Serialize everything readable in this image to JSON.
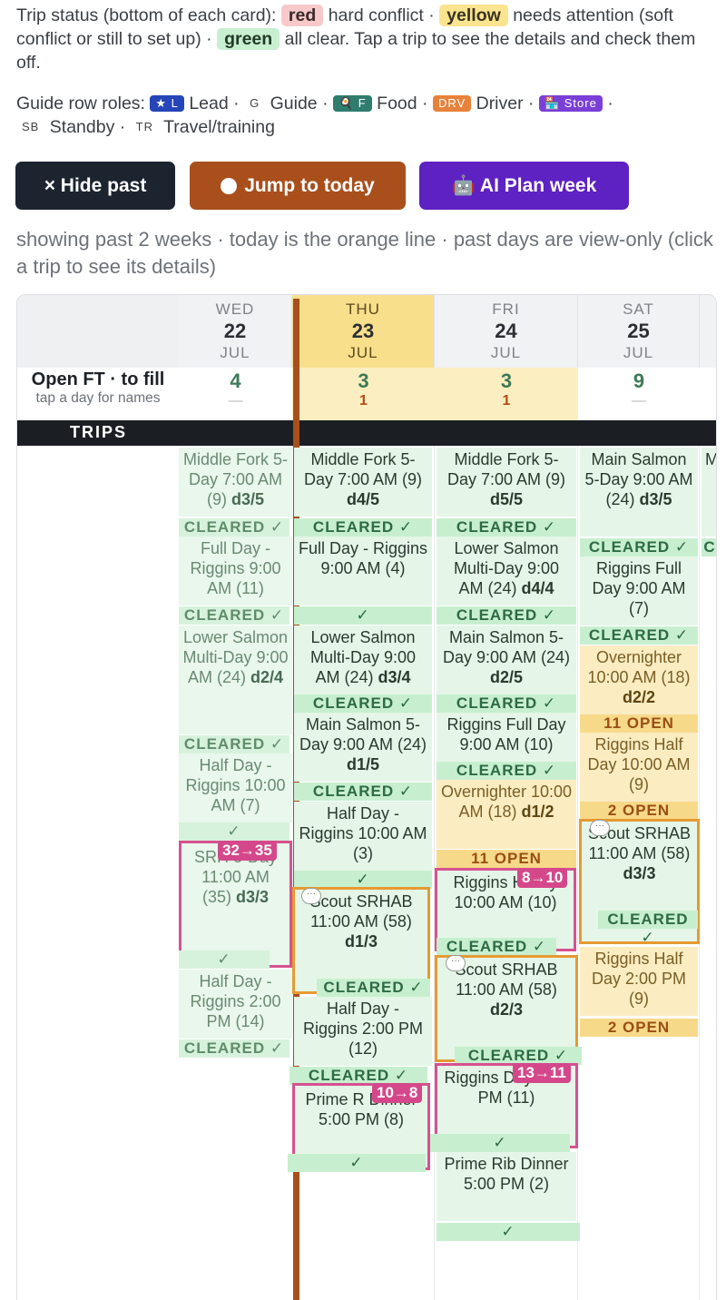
{
  "legend": {
    "status_intro": "Trip status (bottom of each card):",
    "red_label": "red",
    "red_desc": "hard conflict ·",
    "yellow_label": "yellow",
    "yellow_desc": "needs attention (soft conflict or still to set up) ·",
    "green_label": "green",
    "green_desc": "all clear. Tap a trip to see the details and check them off.",
    "roles_intro": "Guide row roles:",
    "roles": [
      {
        "badge": "★ L",
        "name": "Lead"
      },
      {
        "badge": "G",
        "name": "Guide"
      },
      {
        "badge": "🍳 F",
        "name": "Food"
      },
      {
        "badge": "DRV",
        "name": "Driver"
      },
      {
        "badge": "🏪 Store",
        "name": ""
      },
      {
        "badge": "SB",
        "name": "Standby"
      },
      {
        "badge": "TR",
        "name": "Travel/training"
      }
    ],
    "sep": "·"
  },
  "toolbar": {
    "hide_past": "× Hide past",
    "jump_today": "Jump to today",
    "ai_plan": "🤖  AI Plan week"
  },
  "subnote": "showing past 2 weeks · today is the orange line · past days are view-only (click a trip to see its details)",
  "days": [
    {
      "dow": "WED",
      "num": "22",
      "mon": "JUL",
      "open": "4",
      "open_sub": "—"
    },
    {
      "dow": "THU",
      "num": "23",
      "mon": "JUL",
      "open": "3",
      "open_sub": "1"
    },
    {
      "dow": "FRI",
      "num": "24",
      "mon": "JUL",
      "open": "3",
      "open_sub": "1"
    },
    {
      "dow": "SAT",
      "num": "25",
      "mon": "JUL",
      "open": "9",
      "open_sub": "—"
    }
  ],
  "open_row": {
    "title": "Open FT · to fill",
    "sub": "tap a day for names"
  },
  "trips_label": "TRIPS",
  "cards": {
    "wed": [
      {
        "text": "Middle Fork 5-Day 7:00 AM (9)",
        "day": "d3/5",
        "status": "CLEARED ✓"
      },
      {
        "text": "Full Day - Riggins 9:00 AM (11)",
        "day": "",
        "status": "CLEARED ✓"
      },
      {
        "text": "Lower Salmon Multi-Day 9:00 AM (24)",
        "day": "d2/4",
        "status": "CLEARED ✓"
      },
      {
        "text": "Half Day - Riggins 10:00 AM (7)",
        "day": "",
        "status": "✓"
      },
      {
        "text": "SRH 3-Day 11:00 AM (35)",
        "day": "d3/3",
        "status": "✓",
        "badge": "32→35"
      },
      {
        "text": "Half Day - Riggins 2:00 PM (14)",
        "day": "",
        "status": "CLEARED ✓"
      }
    ],
    "thu": [
      {
        "text": "Middle Fork 5-Day 7:00 AM (9)",
        "day": "d4/5",
        "status": "CLEARED ✓"
      },
      {
        "text": "Full Day - Riggins 9:00 AM (4)",
        "day": "",
        "status": "✓"
      },
      {
        "text": "Lower Salmon Multi-Day 9:00 AM (24)",
        "day": "d3/4",
        "status": "CLEARED ✓"
      },
      {
        "text": "Main Salmon 5-Day 9:00 AM (24)",
        "day": "d1/5",
        "status": "CLEARED ✓"
      },
      {
        "text": "Half Day - Riggins 10:00 AM (3)",
        "day": "",
        "status": "✓"
      },
      {
        "text": "Scout SRHAB 11:00 AM (58)",
        "day": "d1/3",
        "status": "CLEARED ✓"
      },
      {
        "text": "Half Day - Riggins 2:00 PM (12)",
        "day": "",
        "status": "CLEARED ✓"
      },
      {
        "text": "Prime R Dinner 5:00 PM (8)",
        "day": "",
        "status": "✓",
        "badge": "10→8"
      }
    ],
    "fri": [
      {
        "text": "Middle Fork 5-Day 7:00 AM (9)",
        "day": "d5/5",
        "status": "CLEARED ✓"
      },
      {
        "text": "Lower Salmon Multi-Day 9:00 AM (24)",
        "day": "d4/4",
        "status": "CLEARED ✓"
      },
      {
        "text": "Main Salmon 5-Day 9:00 AM (24)",
        "day": "d2/5",
        "status": "CLEARED ✓"
      },
      {
        "text": "Riggins Full Day 9:00 AM (10)",
        "day": "",
        "status": "CLEARED ✓"
      },
      {
        "text": "Overnighter 10:00 AM (18)",
        "day": "d1/2",
        "status": "11 OPEN"
      },
      {
        "text": "Riggins H Day 10:00 AM (10)",
        "day": "",
        "status": "CLEARED ✓",
        "badge": "8→10"
      },
      {
        "text": "Scout SRHAB 11:00 AM (58)",
        "day": "d2/3",
        "status": "CLEARED ✓"
      },
      {
        "text": "Riggins Day 2:00 PM (11)",
        "day": "",
        "status": "✓",
        "badge": "13→11"
      },
      {
        "text": "Prime Rib Dinner 5:00 PM (2)",
        "day": "",
        "status": "✓"
      }
    ],
    "sat": [
      {
        "text": "Main Salmon 5-Day 9:00 AM (24)",
        "day": "d3/5",
        "status": "CLEARED ✓"
      },
      {
        "text": "Riggins Full Day 9:00 AM (7)",
        "day": "",
        "status": "CLEARED ✓"
      },
      {
        "text": "Overnighter 10:00 AM (18)",
        "day": "d2/2",
        "status": "11 OPEN"
      },
      {
        "text": "Riggins Half Day 10:00 AM (9)",
        "day": "",
        "status": "2 OPEN"
      },
      {
        "text": "Scout SRHAB 11:00 AM (58)",
        "day": "d3/3",
        "status": "CLEARED ✓"
      },
      {
        "text": "Riggins Half Day 2:00 PM (9)",
        "day": "",
        "status": "2 OPEN"
      }
    ],
    "next_partial": [
      {
        "text": "M",
        "status": "C"
      }
    ]
  },
  "colors": {
    "today_line": "#a84f1c",
    "cleared_bg": "#c7efcf",
    "open_bg": "#f7d98a",
    "conflict_border": "#d6528f",
    "scout_border": "#e69a32"
  }
}
